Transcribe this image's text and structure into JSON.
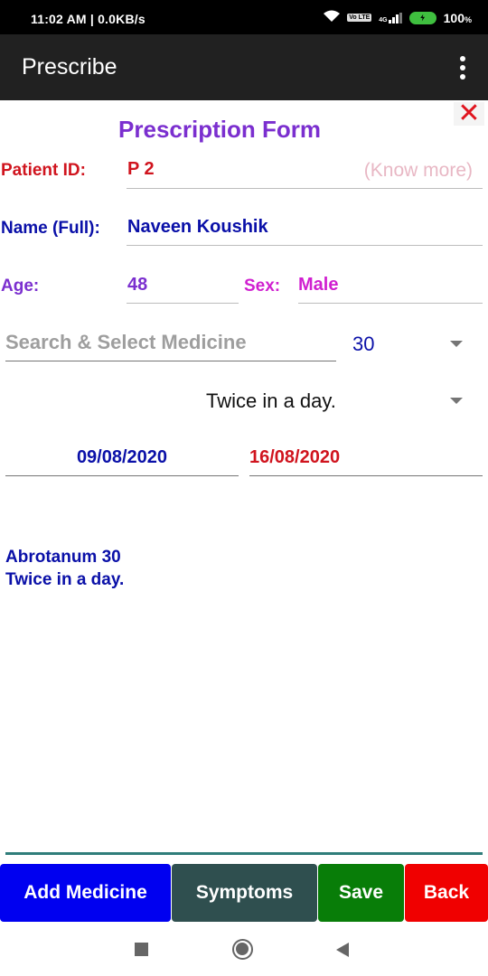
{
  "status_bar": {
    "time_speed": "11:02 AM | 0.0KB/s",
    "network_type": "4G",
    "volte": "Vo LTE",
    "battery": "100",
    "battery_unit": "%"
  },
  "app_bar": {
    "title": "Prescribe",
    "overflow_icon": "more-vert-icon"
  },
  "form": {
    "close_icon": "close-icon",
    "title": "Prescription Form",
    "patient_id_label": "Patient ID:",
    "patient_id_value": "P 2",
    "know_more_link": "(Know more)",
    "name_label": "Name (Full):",
    "name_value": "Naveen Koushik",
    "age_label": "Age:",
    "age_value": "48",
    "sex_label": "Sex:",
    "sex_value": "Male",
    "medicine_search_placeholder": "Search & Select Medicine",
    "potency_selected": "30",
    "frequency_selected": "Twice in a day.",
    "start_date": "09/08/2020",
    "end_date": "16/08/2020"
  },
  "medicine_list": [
    {
      "line1": "Abrotanum 30",
      "line2": "Twice in a day."
    }
  ],
  "buttons": {
    "add_medicine": "Add Medicine",
    "symptoms": "Symptoms",
    "save": "Save",
    "back": "Back"
  },
  "colors": {
    "app_bar": "#212121",
    "title": "#7b2fcf",
    "patient_id": "#d0141e",
    "name": "#0a10a8",
    "age": "#7b2fcf",
    "sex": "#d020d0",
    "add_medicine_button": "#0000f0",
    "symptoms_button": "#2f4f4f",
    "save_button": "#087d08",
    "back_button": "#f00000"
  }
}
